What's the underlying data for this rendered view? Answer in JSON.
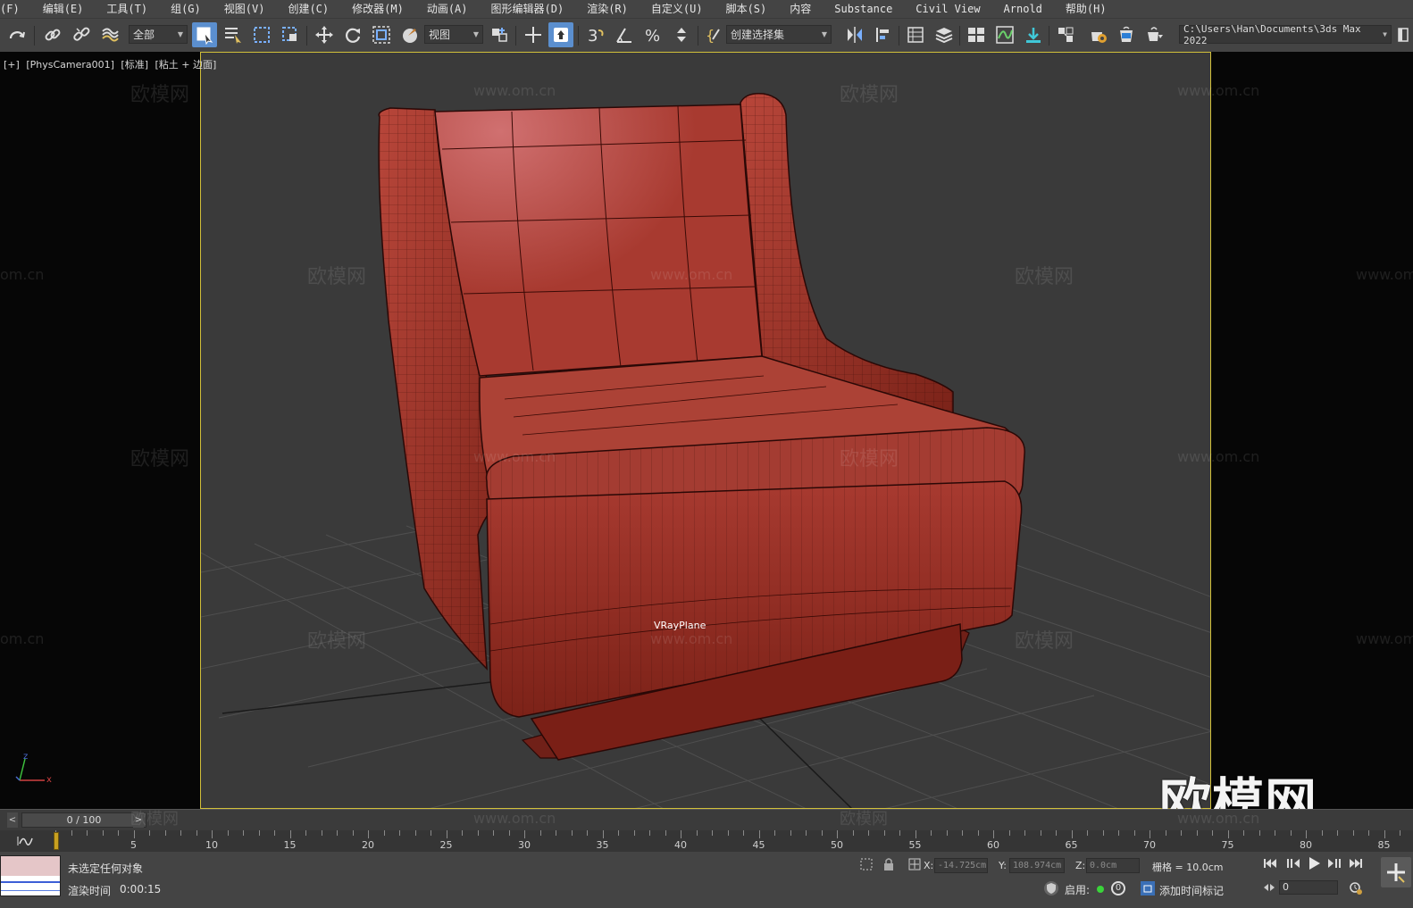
{
  "menu": [
    "(F)",
    "编辑(E)",
    "工具(T)",
    "组(G)",
    "视图(V)",
    "创建(C)",
    "修改器(M)",
    "动画(A)",
    "图形编辑器(D)",
    "渲染(R)",
    "自定义(U)",
    "脚本(S)",
    "内容",
    "Substance",
    "Civil View",
    "Arnold",
    "帮助(H)"
  ],
  "toolbar": {
    "selection_filter": "全部",
    "ref_coord": "视图",
    "named_selection": "创建选择集",
    "project_path": "C:\\Users\\Han\\Documents\\3ds Max 2022"
  },
  "viewport": {
    "label_plus": "[+]",
    "label_camera": "[PhysCamera001]",
    "label_shading": "[标准]",
    "label_mode": "[粘土 + 边面]",
    "object_label": "VRayPlane",
    "axis_x": "x",
    "axis_z": "z"
  },
  "watermark": {
    "text": "欧模网",
    "url": "www.om.cn",
    "url_partial": "om.cn"
  },
  "brand": "欧模网",
  "timeline": {
    "slider": "0 / 100",
    "ticks": [
      "5",
      "10",
      "15",
      "20",
      "25",
      "30",
      "35",
      "40",
      "45",
      "50",
      "55",
      "60",
      "65",
      "70",
      "75",
      "80",
      "85"
    ],
    "current_frame": 0
  },
  "status": {
    "selection": "未选定任何对象",
    "render_time_label": "渲染时间",
    "render_time": "0:00:15",
    "x_label": "X:",
    "x_value": "-14.725cm",
    "y_label": "Y:",
    "y_value": "108.974cm",
    "z_label": "Z:",
    "z_value": "0.0cm",
    "grid": "栅格 = 10.0cm",
    "enable_label": "启用:",
    "enable_count": "0",
    "add_time_tag": "添加时间标记",
    "frame": "0"
  },
  "colors": {
    "accent": "#5b8fcf",
    "viewport_border": "#d2c03a",
    "model_red": "#a8372c"
  }
}
